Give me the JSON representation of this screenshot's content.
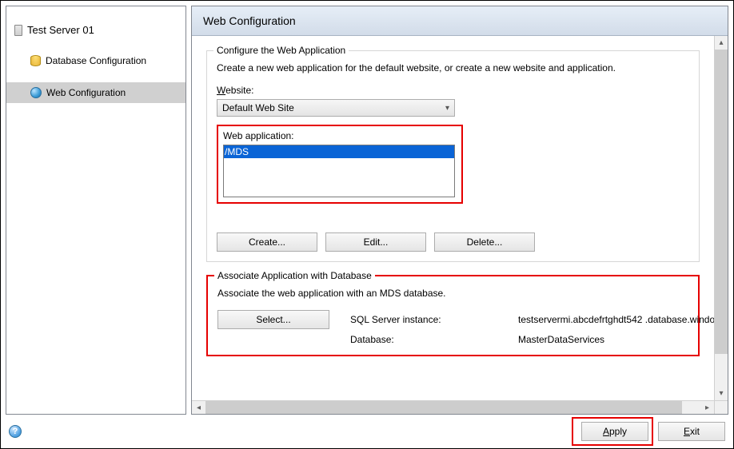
{
  "sidebar": {
    "server_name": "Test Server 01",
    "items": [
      {
        "label": "Database Configuration"
      },
      {
        "label": "Web Configuration"
      }
    ]
  },
  "header": {
    "title": "Web Configuration"
  },
  "configure_group": {
    "legend": "Configure the Web Application",
    "description": "Create a new web application for the default website, or create a new website and application.",
    "website_label_pre": "W",
    "website_label_post": "ebsite:",
    "website_value": "Default Web Site",
    "webapp_label": "Web application:",
    "webapp_items": [
      "/MDS"
    ],
    "buttons": {
      "create": "Create...",
      "edit": "Edit...",
      "delete": "Delete..."
    }
  },
  "associate_group": {
    "legend": "Associate Application with Database",
    "description": "Associate the web application with an MDS database.",
    "select_button": "Select...",
    "sql_label": "SQL Server instance:",
    "sql_value": "testservermi.abcdefrtghdt542 .database.windo",
    "db_label": "Database:",
    "db_value": "MasterDataServices"
  },
  "footer": {
    "apply_pre": "A",
    "apply_post": "pply",
    "exit_pre": "E",
    "exit_post": "xit"
  }
}
